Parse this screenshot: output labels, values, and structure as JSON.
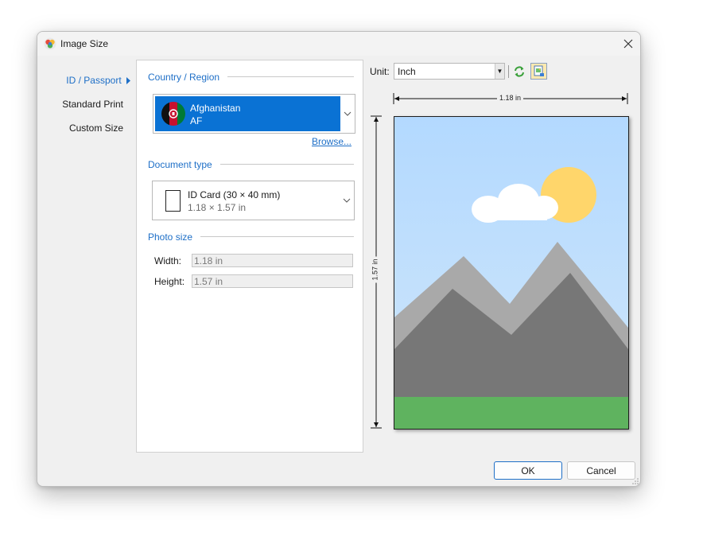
{
  "window": {
    "title": "Image Size",
    "close_glyph": "✕"
  },
  "nav": {
    "items": [
      {
        "label": "ID / Passport",
        "active": true
      },
      {
        "label": "Standard Print",
        "active": false
      },
      {
        "label": "Custom Size",
        "active": false
      }
    ]
  },
  "country": {
    "section_label": "Country / Region",
    "name": "Afghanistan",
    "code": "AF",
    "browse_label": "Browse..."
  },
  "document": {
    "section_label": "Document type",
    "name": "ID Card (30 × 40 mm)",
    "size": "1.18 × 1.57 in"
  },
  "photo_size": {
    "section_label": "Photo size",
    "width_label": "Width:",
    "width_value": "1.18 in",
    "height_label": "Height:",
    "height_value": "1.57 in"
  },
  "toolbar": {
    "unit_label": "Unit:",
    "unit_value": "Inch",
    "icons": [
      "refresh-icon",
      "image-settings-icon"
    ]
  },
  "preview": {
    "width_dimension": "1.18 in",
    "height_dimension": "1.57 in"
  },
  "buttons": {
    "ok": "OK",
    "cancel": "Cancel"
  },
  "colors": {
    "accent": "#1e6fc7",
    "selection": "#0a72d4",
    "sky": "#a8d3ff",
    "sun": "#ffd66b",
    "mountain_far": "#a9a9a9",
    "mountain_near": "#777777",
    "grass": "#5fb35f"
  }
}
